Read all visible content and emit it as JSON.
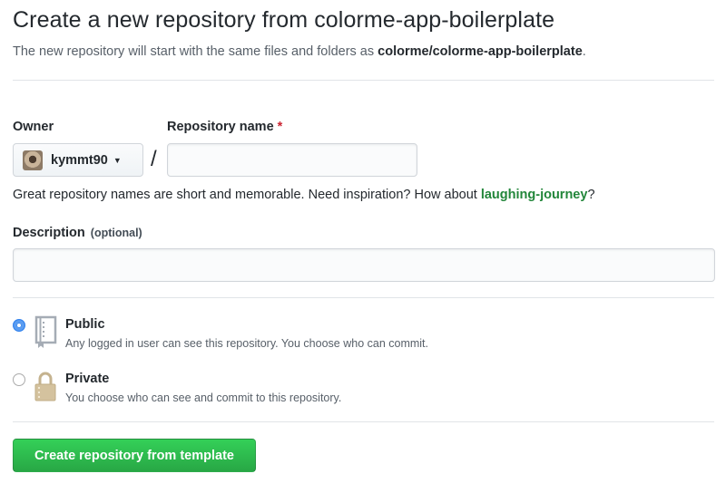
{
  "header": {
    "title": "Create a new repository from colorme-app-boilerplate",
    "subtitle_prefix": "The new repository will start with the same files and folders as ",
    "template_name": "colorme/colorme-app-boilerplate",
    "subtitle_suffix": "."
  },
  "owner": {
    "label": "Owner",
    "selected": "kymmt90"
  },
  "repo_name": {
    "label": "Repository name",
    "required_mark": "*",
    "value": "",
    "separator": "/"
  },
  "name_help": {
    "text": "Great repository names are short and memorable. Need inspiration? How about ",
    "suggestion": "laughing-journey",
    "suffix": "?"
  },
  "description": {
    "label": "Description",
    "optional": "(optional)",
    "value": ""
  },
  "visibility": {
    "selected": "public",
    "public": {
      "title": "Public",
      "desc": "Any logged in user can see this repository. You choose who can commit.",
      "icon": "repo-icon"
    },
    "private": {
      "title": "Private",
      "desc": "You choose who can see and commit to this repository.",
      "icon": "lock-icon"
    }
  },
  "submit": {
    "label": "Create repository from template",
    "color": "#28a745"
  }
}
